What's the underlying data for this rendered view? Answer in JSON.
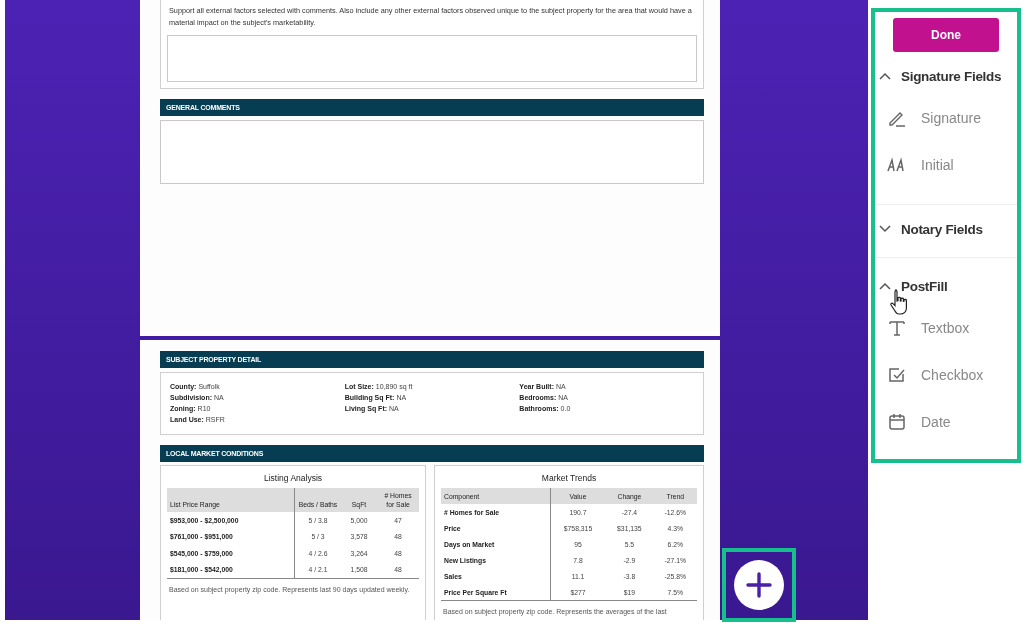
{
  "page_1": {
    "note": "Support all external factors selected with comments. Also include any other external factors observed unique to the subject property for the area that would have a material impact on the subject's marketability.",
    "general_comments": {
      "title": "GENERAL COMMENTS"
    }
  },
  "page_2": {
    "property_detail": {
      "title": "SUBJECT PROPERTY DETAIL",
      "columns": [
        [
          {
            "label": "County:",
            "value": "Suffolk"
          },
          {
            "label": "Subdivision:",
            "value": "NA"
          },
          {
            "label": "Zoning:",
            "value": "R10"
          },
          {
            "label": "Land Use:",
            "value": "RSFR"
          }
        ],
        [
          {
            "label": "Lot Size:",
            "value": "10,890 sq ft"
          },
          {
            "label": "Building Sq Ft:",
            "value": "NA"
          },
          {
            "label": "Living Sq Ft:",
            "value": "NA"
          }
        ],
        [
          {
            "label": "Year Built:",
            "value": "NA"
          },
          {
            "label": "Bedrooms:",
            "value": "NA"
          },
          {
            "label": "Bathrooms:",
            "value": "0.0"
          }
        ]
      ]
    },
    "market_conditions": {
      "title": "LOCAL MARKET CONDITIONS",
      "listing_analysis": {
        "title": "Listing Analysis",
        "columns": [
          "List Price Range",
          "Beds / Baths",
          "SqFt",
          "# Homes for Sale"
        ],
        "rows": [
          [
            "$953,000 - $2,500,000",
            "5 / 3.8",
            "5,000",
            "47"
          ],
          [
            "$761,000 - $951,000",
            "5 / 3",
            "3,578",
            "48"
          ],
          [
            "$545,000 - $759,000",
            "4 / 2.6",
            "3,264",
            "48"
          ],
          [
            "$181,000 - $542,000",
            "4 / 2.1",
            "1,508",
            "48"
          ]
        ],
        "footnote": "Based on subject property zip code. Represents last 90 days updated weekly."
      },
      "market_trends": {
        "title": "Market Trends",
        "columns": [
          "Component",
          "Value",
          "Change",
          "Trend"
        ],
        "rows": [
          [
            "# Homes for Sale",
            "190.7",
            "-27.4",
            "-12.6%"
          ],
          [
            "Price",
            "$758,315",
            "$31,135",
            "4.3%"
          ],
          [
            "Days on Market",
            "95",
            "5.5",
            "6.2%"
          ],
          [
            "New Listings",
            "7.8",
            "-2.9",
            "-27.1%"
          ],
          [
            "Sales",
            "11.1",
            "-3.8",
            "-25.8%"
          ],
          [
            "Price Per Square Ft",
            "$277",
            "$19",
            "7.5%"
          ]
        ],
        "footnote": "Based on subject property zip code. Represents the averages of the last"
      }
    }
  },
  "panel": {
    "done_button": "Done",
    "groups": [
      {
        "title": "Signature Fields",
        "expanded": true,
        "items": [
          {
            "label": "Signature",
            "kind": "signature"
          },
          {
            "label": "Initial",
            "kind": "initial"
          }
        ]
      },
      {
        "title": "Notary Fields",
        "expanded": false
      },
      {
        "title": "PostFill",
        "expanded": true,
        "items": [
          {
            "label": "Textbox",
            "kind": "textbox"
          },
          {
            "label": "Checkbox",
            "kind": "checkbox"
          },
          {
            "label": "Date",
            "kind": "date"
          }
        ]
      }
    ]
  }
}
